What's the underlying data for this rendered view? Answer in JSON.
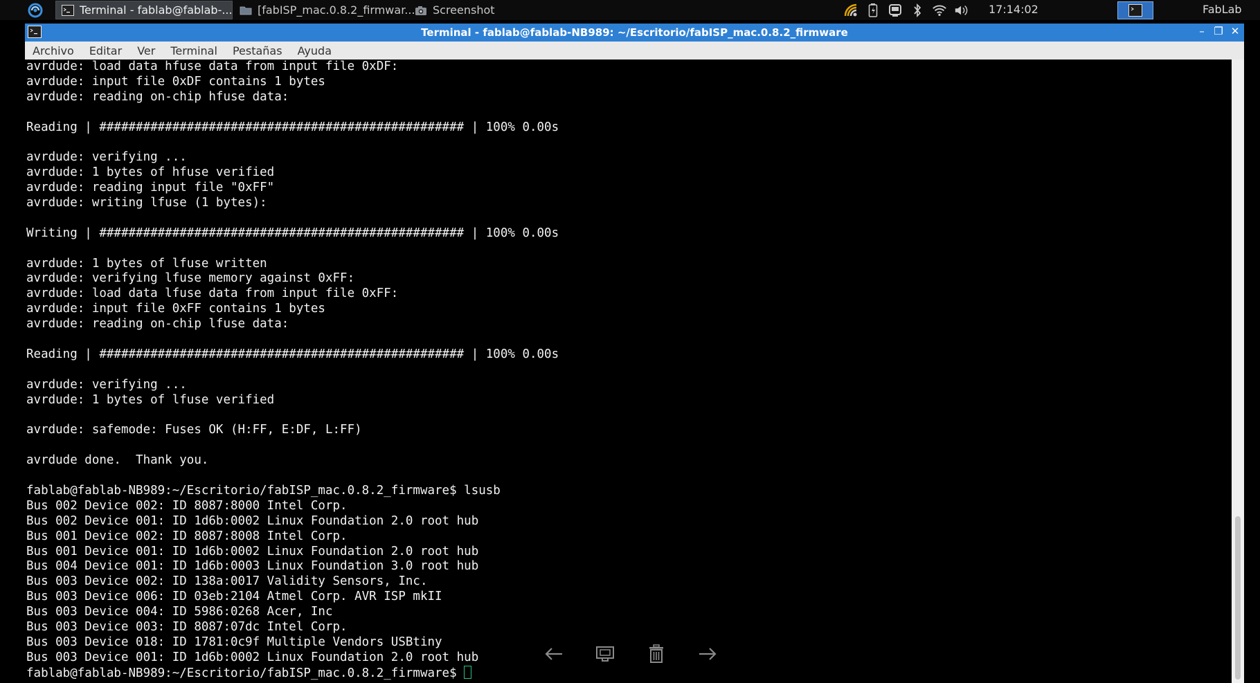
{
  "panel": {
    "tasks": [
      {
        "label": "Terminal - fablab@fablab-...",
        "icon": "terminal-icon"
      },
      {
        "label": "[fabISP_mac.0.8.2_firmwar...",
        "icon": "folder-icon"
      },
      {
        "label": "Screenshot",
        "icon": "camera-icon"
      }
    ],
    "clock": "17:14:02",
    "user": "FabLab",
    "tray_icons": [
      "network-signal-icon",
      "battery-icon",
      "usb-device-icon",
      "bluetooth-icon",
      "wifi-icon",
      "volume-icon"
    ]
  },
  "window": {
    "title": "Terminal - fablab@fablab-NB989: ~/Escritorio/fabISP_mac.0.8.2_firmware"
  },
  "menubar": [
    "Archivo",
    "Editar",
    "Ver",
    "Terminal",
    "Pestañas",
    "Ayuda"
  ],
  "terminal": {
    "lines": [
      "avrdude: load data hfuse data from input file 0xDF:",
      "avrdude: input file 0xDF contains 1 bytes",
      "avrdude: reading on-chip hfuse data:",
      "",
      "Reading | ################################################## | 100% 0.00s",
      "",
      "avrdude: verifying ...",
      "avrdude: 1 bytes of hfuse verified",
      "avrdude: reading input file \"0xFF\"",
      "avrdude: writing lfuse (1 bytes):",
      "",
      "Writing | ################################################## | 100% 0.00s",
      "",
      "avrdude: 1 bytes of lfuse written",
      "avrdude: verifying lfuse memory against 0xFF:",
      "avrdude: load data lfuse data from input file 0xFF:",
      "avrdude: input file 0xFF contains 1 bytes",
      "avrdude: reading on-chip lfuse data:",
      "",
      "Reading | ################################################## | 100% 0.00s",
      "",
      "avrdude: verifying ...",
      "avrdude: 1 bytes of lfuse verified",
      "",
      "avrdude: safemode: Fuses OK (H:FF, E:DF, L:FF)",
      "",
      "avrdude done.  Thank you.",
      "",
      "fablab@fablab-NB989:~/Escritorio/fabISP_mac.0.8.2_firmware$ lsusb",
      "Bus 002 Device 002: ID 8087:8000 Intel Corp.",
      "Bus 002 Device 001: ID 1d6b:0002 Linux Foundation 2.0 root hub",
      "Bus 001 Device 002: ID 8087:8008 Intel Corp.",
      "Bus 001 Device 001: ID 1d6b:0002 Linux Foundation 2.0 root hub",
      "Bus 004 Device 001: ID 1d6b:0003 Linux Foundation 3.0 root hub",
      "Bus 003 Device 002: ID 138a:0017 Validity Sensors, Inc.",
      "Bus 003 Device 006: ID 03eb:2104 Atmel Corp. AVR ISP mkII",
      "Bus 003 Device 004: ID 5986:0268 Acer, Inc",
      "Bus 003 Device 003: ID 8087:07dc Intel Corp.",
      "Bus 003 Device 018: ID 1781:0c9f Multiple Vendors USBtiny",
      "Bus 003 Device 001: ID 1d6b:0002 Linux Foundation 2.0 root hub"
    ],
    "prompt": "fablab@fablab-NB989:~/Escritorio/fabISP_mac.0.8.2_firmware$ "
  },
  "viewer_toolbar": [
    "back-arrow-icon",
    "set-wallpaper-icon",
    "trash-icon",
    "forward-arrow-icon"
  ],
  "colors": {
    "titlebar": "#2e80d4",
    "panel": "#0c0c0c",
    "terminal_bg": "#000000",
    "terminal_fg": "#f2f2f2",
    "cursor": "#27c27c"
  }
}
